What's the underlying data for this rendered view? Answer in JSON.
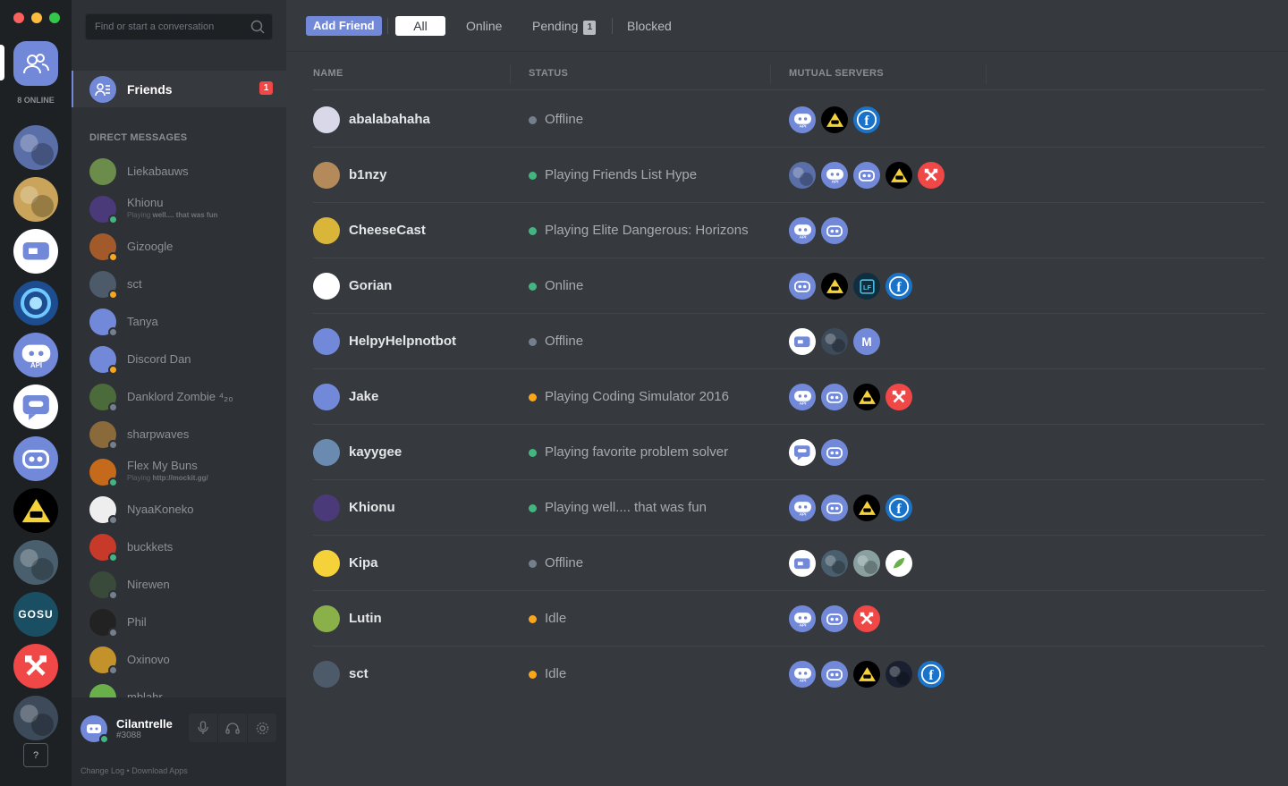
{
  "rail": {
    "online_count": "8 ONLINE",
    "help_label": "?",
    "servers": [
      {
        "name": "dragon-art",
        "color": "#5a6fa8"
      },
      {
        "name": "face-art",
        "color": "#c9a45a"
      },
      {
        "name": "discord-tv",
        "color": "#ffffff"
      },
      {
        "name": "heroes-swirl",
        "color": "#1d4c8f"
      },
      {
        "name": "discord-api",
        "color": "#7289da",
        "text": "API"
      },
      {
        "name": "discord-chat",
        "color": "#ffffff"
      },
      {
        "name": "discord-gamepad",
        "color": "#7289da"
      },
      {
        "name": "warning-triangle",
        "color": "#000000"
      },
      {
        "name": "racing-art",
        "color": "#4a5f6e"
      },
      {
        "name": "gosu",
        "color": "#1a4f63",
        "text": "GOSU"
      },
      {
        "name": "hammer-wrench",
        "color": "#f04747"
      },
      {
        "name": "jet-art",
        "color": "#3d4a5a"
      }
    ]
  },
  "search": {
    "placeholder": "Find or start a conversation"
  },
  "friends_nav": {
    "label": "Friends",
    "badge": "1"
  },
  "dm_header": "DIRECT MESSAGES",
  "direct_messages": [
    {
      "name": "Liekabauws",
      "avatar": "#6b8c4a",
      "status": "none"
    },
    {
      "name": "Khionu",
      "avatar": "#4b3a7a",
      "status": "online",
      "sub_prefix": "Playing ",
      "sub_bold": "well.... that was fun"
    },
    {
      "name": "Gizoogle",
      "avatar": "#a35a2a",
      "status": "idle"
    },
    {
      "name": "sct",
      "avatar": "#4d5a6a",
      "status": "idle"
    },
    {
      "name": "Tanya",
      "avatar": "#7289da",
      "status": "offline"
    },
    {
      "name": "Discord Dan",
      "avatar": "#7289da",
      "status": "idle"
    },
    {
      "name": "Danklord Zombie ⁴₂₀",
      "avatar": "#4b6b3a",
      "status": "offline"
    },
    {
      "name": "sharpwaves",
      "avatar": "#8a6a3a",
      "status": "offline"
    },
    {
      "name": "Flex My Buns",
      "avatar": "#c46a1a",
      "status": "online",
      "sub_prefix": "Playing ",
      "sub_bold": "http://mockit.gg/"
    },
    {
      "name": "NyaaKoneko",
      "avatar": "#eeeeee",
      "status": "offline"
    },
    {
      "name": "buckkets",
      "avatar": "#c73a2a",
      "status": "online"
    },
    {
      "name": "Nirewen",
      "avatar": "#3a4a3a",
      "status": "offline"
    },
    {
      "name": "Phil",
      "avatar": "#222222",
      "status": "offline"
    },
    {
      "name": "Oxinovo",
      "avatar": "#c4922a",
      "status": "offline"
    },
    {
      "name": "mblahr",
      "avatar": "#6ab04a",
      "status": "none"
    }
  ],
  "user": {
    "name": "Cilantrelle",
    "discriminator": "#3088"
  },
  "footer": "Change Log  •  Download Apps",
  "topbar": {
    "add_friend": "Add Friend",
    "tabs": {
      "all": "All",
      "online": "Online",
      "pending": "Pending",
      "blocked": "Blocked"
    },
    "pending_count": "1"
  },
  "columns": {
    "name": "NAME",
    "status": "STATUS",
    "mutual": "MUTUAL SERVERS"
  },
  "colors": {
    "online": "#43b581",
    "idle": "#faa61a",
    "offline": "#747f8d",
    "blurple": "#7289da",
    "red": "#f04747"
  },
  "friends": [
    {
      "name": "abalabahaha",
      "avatar": "#d8d8e8",
      "status_kind": "offline",
      "status": "Offline",
      "servers": [
        {
          "c": "#7289da",
          "i": "api"
        },
        {
          "c": "#000000",
          "i": "tri"
        },
        {
          "c": "#1a73c8",
          "i": "f"
        }
      ]
    },
    {
      "name": "b1nzy",
      "avatar": "#b58a5a",
      "status_kind": "online",
      "status": "Playing Friends List Hype",
      "servers": [
        {
          "c": "#5a6fa8",
          "i": "art"
        },
        {
          "c": "#7289da",
          "i": "api"
        },
        {
          "c": "#7289da",
          "i": "pad"
        },
        {
          "c": "#000000",
          "i": "tri"
        },
        {
          "c": "#f04747",
          "i": "ham"
        }
      ]
    },
    {
      "name": "CheeseCast",
      "avatar": "#d9b53a",
      "status_kind": "online",
      "status": "Playing Elite Dangerous: Horizons",
      "servers": [
        {
          "c": "#7289da",
          "i": "api"
        },
        {
          "c": "#7289da",
          "i": "pad"
        }
      ]
    },
    {
      "name": "Gorian",
      "avatar": "#ffffff",
      "status_kind": "online",
      "status": "Online",
      "servers": [
        {
          "c": "#7289da",
          "i": "pad"
        },
        {
          "c": "#000000",
          "i": "tri"
        },
        {
          "c": "#0f2f3f",
          "i": "lf"
        },
        {
          "c": "#1a73c8",
          "i": "f"
        }
      ]
    },
    {
      "name": "HelpyHelpnotbot",
      "avatar": "#7289da",
      "status_kind": "offline",
      "status": "Offline",
      "servers": [
        {
          "c": "#ffffff",
          "i": "tv"
        },
        {
          "c": "#3d4a5a",
          "i": "art"
        },
        {
          "c": "#7289da",
          "i": "M"
        }
      ]
    },
    {
      "name": "Jake",
      "avatar": "#7289da",
      "status_kind": "idle",
      "status": "Playing Coding Simulator 2016",
      "servers": [
        {
          "c": "#7289da",
          "i": "api"
        },
        {
          "c": "#7289da",
          "i": "pad"
        },
        {
          "c": "#000000",
          "i": "tri"
        },
        {
          "c": "#f04747",
          "i": "ham"
        }
      ]
    },
    {
      "name": "kayygee",
      "avatar": "#6a8ab0",
      "status_kind": "online",
      "status": "Playing favorite problem solver",
      "servers": [
        {
          "c": "#ffffff",
          "i": "chat"
        },
        {
          "c": "#7289da",
          "i": "pad"
        }
      ]
    },
    {
      "name": "Khionu",
      "avatar": "#4b3a7a",
      "status_kind": "online",
      "status": "Playing well.... that was fun",
      "servers": [
        {
          "c": "#7289da",
          "i": "api"
        },
        {
          "c": "#7289da",
          "i": "pad"
        },
        {
          "c": "#000000",
          "i": "tri"
        },
        {
          "c": "#1a73c8",
          "i": "f"
        }
      ]
    },
    {
      "name": "Kipa",
      "avatar": "#f6d23a",
      "status_kind": "offline",
      "status": "Offline",
      "servers": [
        {
          "c": "#ffffff",
          "i": "tv"
        },
        {
          "c": "#4a5f6e",
          "i": "art"
        },
        {
          "c": "#8aa0a0",
          "i": "art"
        },
        {
          "c": "#ffffff",
          "i": "leaf"
        }
      ]
    },
    {
      "name": "Lutin",
      "avatar": "#8ab04a",
      "status_kind": "idle",
      "status": "Idle",
      "servers": [
        {
          "c": "#7289da",
          "i": "api"
        },
        {
          "c": "#7289da",
          "i": "pad"
        },
        {
          "c": "#f04747",
          "i": "ham"
        }
      ]
    },
    {
      "name": "sct",
      "avatar": "#4d5a6a",
      "status_kind": "idle",
      "status": "Idle",
      "servers": [
        {
          "c": "#7289da",
          "i": "api"
        },
        {
          "c": "#7289da",
          "i": "pad"
        },
        {
          "c": "#000000",
          "i": "tri"
        },
        {
          "c": "#1a2030",
          "i": "art"
        },
        {
          "c": "#1a73c8",
          "i": "f"
        }
      ]
    }
  ]
}
